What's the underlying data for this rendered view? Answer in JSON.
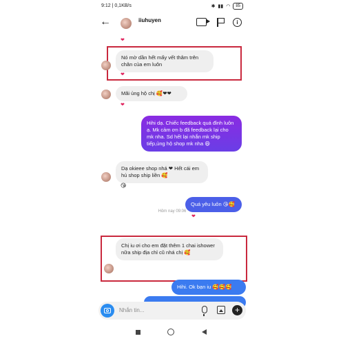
{
  "status_bar": {
    "time": "9:12 | 0,1KB/s",
    "battery": "85"
  },
  "header": {
    "username": "iiuhuyen"
  },
  "messages": {
    "m1": {
      "text": "Nó mờ dần hết mấy vết thâm trên chân của em luôn",
      "reaction": "❤"
    },
    "m2": {
      "text": "Mãi ủng hộ chị 🥰❤❤",
      "reaction": "❤"
    },
    "m3": {
      "text": "Hihi dạ. Chiếc feedback quá đỉnh luôn ạ. Mk cảm ơn b đã feedback lại cho mk nha. Sd hết lại nhắn mk ship tiếp,ủng hộ shop mk nha 😄"
    },
    "m4": {
      "text": "Dạ okieee shop nhá ❤ Hết cái em hú shop ship liền 🥰",
      "reaction": "😘"
    },
    "m5": {
      "text": "Quá yêu luôn 😘🥰",
      "reaction": "❤"
    },
    "timestamp": "Hôm nay 09:06",
    "m6": {
      "text": "Chị iu ơi cho em đặt thêm 1 chai ishower nữa ship địa chỉ cũ nhá chị 🥰"
    },
    "m7": {
      "text": "Hihi. Ok bạn iu 🥰🥰🥰"
    }
  },
  "input": {
    "placeholder": "Nhắn tin..."
  },
  "colors": {
    "outgoing_gradient_top": "#8a2be2",
    "outgoing_gradient_bottom": "#4b5fe8",
    "outgoing_blue": "#3b7bf0",
    "highlight_box": "#c9283d",
    "camera_button": "#2a8cf0"
  },
  "icons": [
    "back-arrow-icon",
    "video-call-icon",
    "flag-icon",
    "info-icon",
    "camera-icon",
    "microphone-icon",
    "gallery-icon",
    "plus-icon"
  ]
}
